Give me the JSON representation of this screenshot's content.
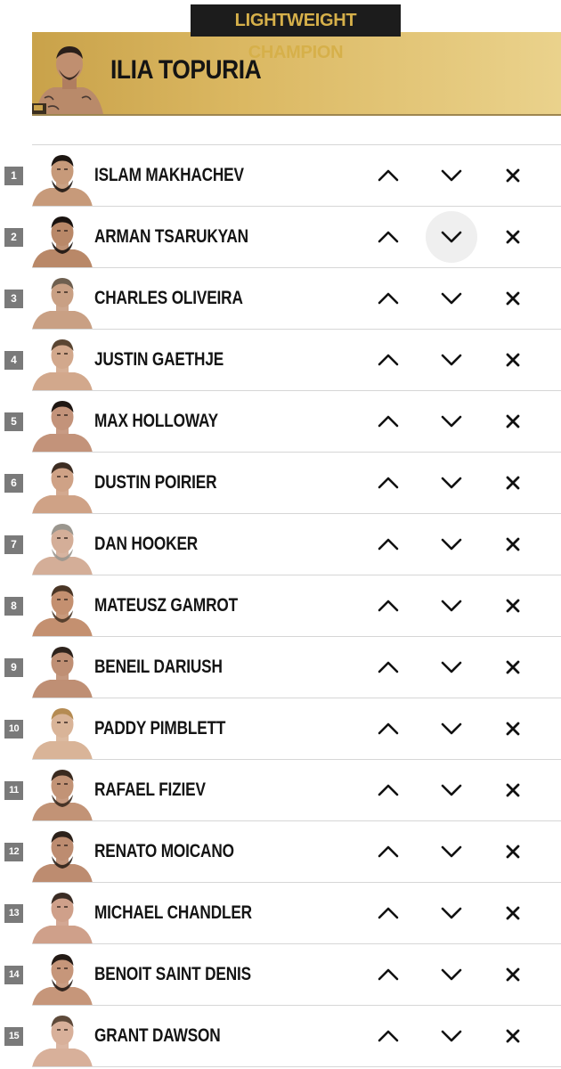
{
  "division": {
    "title": "LIGHTWEIGHT CHAMPION",
    "champion": "ILIA TOPURIA"
  },
  "colors": {
    "gold_band": "#dbb862",
    "gold_text": "#d6b04a",
    "tag_bg": "#1c1c1c",
    "rank_badge": "#7a7a7a",
    "text": "#141414"
  },
  "controls": {
    "up_icon": "chevron-up-icon",
    "down_icon": "chevron-down-icon",
    "remove_icon": "close-icon"
  },
  "fighters": [
    {
      "rank": "1",
      "name": "ISLAM MAKHACHEV"
    },
    {
      "rank": "2",
      "name": "ARMAN TSARUKYAN"
    },
    {
      "rank": "3",
      "name": "CHARLES OLIVEIRA"
    },
    {
      "rank": "4",
      "name": "JUSTIN GAETHJE"
    },
    {
      "rank": "5",
      "name": "MAX HOLLOWAY"
    },
    {
      "rank": "6",
      "name": "DUSTIN POIRIER"
    },
    {
      "rank": "7",
      "name": "DAN HOOKER"
    },
    {
      "rank": "8",
      "name": "MATEUSZ GAMROT"
    },
    {
      "rank": "9",
      "name": "BENEIL DARIUSH"
    },
    {
      "rank": "10",
      "name": "PADDY PIMBLETT"
    },
    {
      "rank": "11",
      "name": "RAFAEL FIZIEV"
    },
    {
      "rank": "12",
      "name": "RENATO MOICANO"
    },
    {
      "rank": "13",
      "name": "MICHAEL CHANDLER"
    },
    {
      "rank": "14",
      "name": "BENOIT SAINT DENIS"
    },
    {
      "rank": "15",
      "name": "GRANT DAWSON"
    }
  ]
}
